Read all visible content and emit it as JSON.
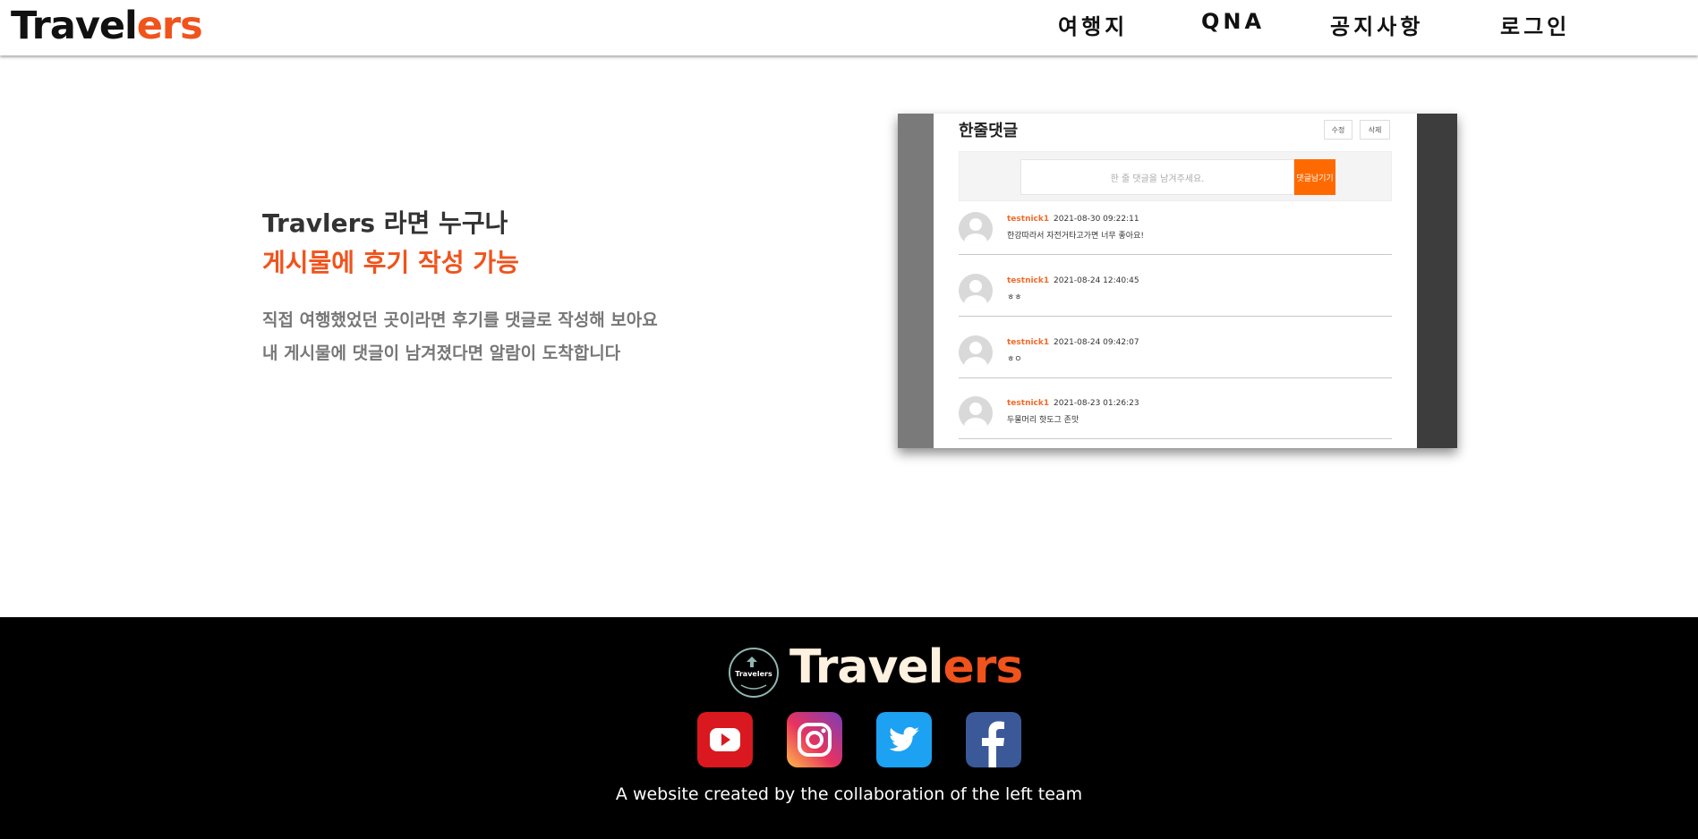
{
  "header": {
    "logo_main": "Travel",
    "logo_accent": "ers",
    "nav": [
      "여행지",
      "QNA",
      "공지사항",
      "로그인"
    ]
  },
  "feature": {
    "title_line1": "Travlers 라면 누구나",
    "title_line2": "게시물에 후기 작성 가능",
    "desc_line1": "직접 여행했었던 곳이라면 후기를 댓글로 작성해 보아요",
    "desc_line2": "내 게시물에 댓글이 남겨졌다면 알람이 도착합니다"
  },
  "preview": {
    "title": "한줄댓글",
    "edit_label": "수정",
    "delete_label": "삭제",
    "input_placeholder": "한 줄 댓글을 남겨주세요.",
    "submit_label": "댓글남기기",
    "comments": [
      {
        "user": "testnick1",
        "date": "2021-08-30 09:22:11",
        "text": "한강따라서 자전거타고가면 너무 좋아요!"
      },
      {
        "user": "testnick1",
        "date": "2021-08-24 12:40:45",
        "text": "ㅎㅎ"
      },
      {
        "user": "testnick1",
        "date": "2021-08-24 09:42:07",
        "text": "ㅎㅇ"
      },
      {
        "user": "testnick1",
        "date": "2021-08-23 01:26:23",
        "text": "두물머리 핫도그 존맛"
      }
    ]
  },
  "footer": {
    "emblem_text": "Travelers",
    "logo_main": "Travel",
    "logo_accent": "ers",
    "social": [
      "youtube-icon",
      "instagram-icon",
      "twitter-icon",
      "facebook-icon"
    ],
    "tagline": "A website created by the collaboration of the left team"
  },
  "colors": {
    "accent": "#f0531c",
    "preview_button": "#ff6a00",
    "footer_bg": "#000000",
    "youtube": "#d9191f",
    "twitter": "#1da1f2",
    "facebook": "#3b5998"
  }
}
